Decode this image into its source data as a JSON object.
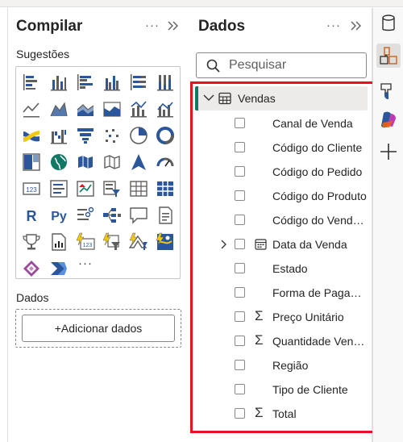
{
  "build_pane": {
    "title": "Compilar",
    "more_label": "···",
    "collapse_icon": "double-chevron-right-icon",
    "suggestions_label": "Sugestões",
    "visual_more_label": "···",
    "data_section_label": "Dados",
    "add_data_label": "+Adicionar dados"
  },
  "data_pane": {
    "title": "Dados",
    "more_label": "···",
    "search_placeholder": "Pesquisar",
    "table_name": "Vendas",
    "fields": [
      {
        "label": "Canal de Venda"
      },
      {
        "label": "Código do Cliente"
      },
      {
        "label": "Código do Pedido"
      },
      {
        "label": "Código do Produto"
      },
      {
        "label": "Código do Vendedor"
      },
      {
        "label": "Data da Venda"
      },
      {
        "label": "Estado"
      },
      {
        "label": "Forma de Pagamento"
      },
      {
        "label": "Preço Unitário"
      },
      {
        "label": "Quantidade Vendida"
      },
      {
        "label": "Região"
      },
      {
        "label": "Tipo de Cliente"
      },
      {
        "label": "Total"
      }
    ]
  },
  "rail": {
    "icons": [
      "database-icon",
      "data-model-icon",
      "format-brush-icon",
      "copilot-icon",
      "add-icon"
    ]
  },
  "colors": {
    "accent_green": "#117865",
    "highlight_red": "#e81123",
    "icon_blue": "#2b579a",
    "icon_yellow": "#f2c811"
  }
}
